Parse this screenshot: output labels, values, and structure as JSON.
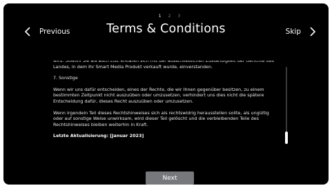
{
  "pagination": {
    "pages": [
      "1",
      "2",
      "3"
    ],
    "active_index": 0
  },
  "header": {
    "title": "Terms & Conditions",
    "previous_label": "Previous",
    "skip_label": "Skip"
  },
  "terms": {
    "cut_line": "wird. Sowohl Sie als auch LGE erklären sich mit der ausschließlichen Zuständigkeit der Gerichte des Landes, in dem Ihr Smart Media Produkt verkauft wurde, einverstanden.",
    "section_heading": "7. Sonstige",
    "paragraph_1": "Wenn wir uns dafür entscheiden, eines der Rechte, die wir Ihnen gegenüber besitzen, zu einem bestimmten Zeitpunkt nicht auszuüben oder umzusetzen, verhindert uns dies nicht die spätere Entscheidung dafür, dieses Recht auszuüben oder umzusetzen.",
    "paragraph_2": "Wenn irgendein Teil dieses Rechtshinweises sich als rechtswidrig herausstellen sollte, als ungültig oder auf sonstige Weise unwirksam, wird dieser Teil gelöscht und die verbleibenden Teile des Rechtshinweises bleiben weiterhin in Kraft.",
    "last_updated": "Letzte Aktualisierung: [Januar 2023]"
  },
  "scrollbar": {
    "position_fraction": 0.84
  },
  "footer": {
    "next_label": "Next"
  },
  "icons": {
    "previous": "chevron-left-icon",
    "skip": "chevron-right-icon"
  },
  "colors": {
    "background": "#000000",
    "button": "#76787c",
    "text": "#ffffff"
  }
}
